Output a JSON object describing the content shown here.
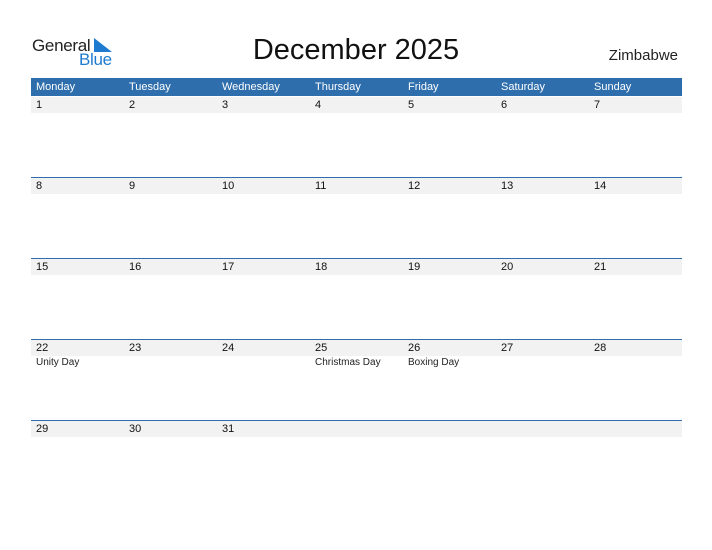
{
  "logo": {
    "general": "General",
    "blue": "Blue"
  },
  "title": "December 2025",
  "country": "Zimbabwe",
  "colors": {
    "header": "#2e6ead",
    "brand": "#1f7bd0",
    "day_bar": "#f2f2f2"
  },
  "weekdays": [
    "Monday",
    "Tuesday",
    "Wednesday",
    "Thursday",
    "Friday",
    "Saturday",
    "Sunday"
  ],
  "weeks": [
    {
      "days": [
        "1",
        "2",
        "3",
        "4",
        "5",
        "6",
        "7"
      ],
      "holidays": [
        "",
        "",
        "",
        "",
        "",
        "",
        ""
      ]
    },
    {
      "days": [
        "8",
        "9",
        "10",
        "11",
        "12",
        "13",
        "14"
      ],
      "holidays": [
        "",
        "",
        "",
        "",
        "",
        "",
        ""
      ]
    },
    {
      "days": [
        "15",
        "16",
        "17",
        "18",
        "19",
        "20",
        "21"
      ],
      "holidays": [
        "",
        "",
        "",
        "",
        "",
        "",
        ""
      ]
    },
    {
      "days": [
        "22",
        "23",
        "24",
        "25",
        "26",
        "27",
        "28"
      ],
      "holidays": [
        "Unity Day",
        "",
        "",
        "Christmas Day",
        "Boxing Day",
        "",
        ""
      ]
    },
    {
      "days": [
        "29",
        "30",
        "31",
        "",
        "",
        "",
        ""
      ],
      "holidays": [
        "",
        "",
        "",
        "",
        "",
        "",
        ""
      ]
    }
  ]
}
